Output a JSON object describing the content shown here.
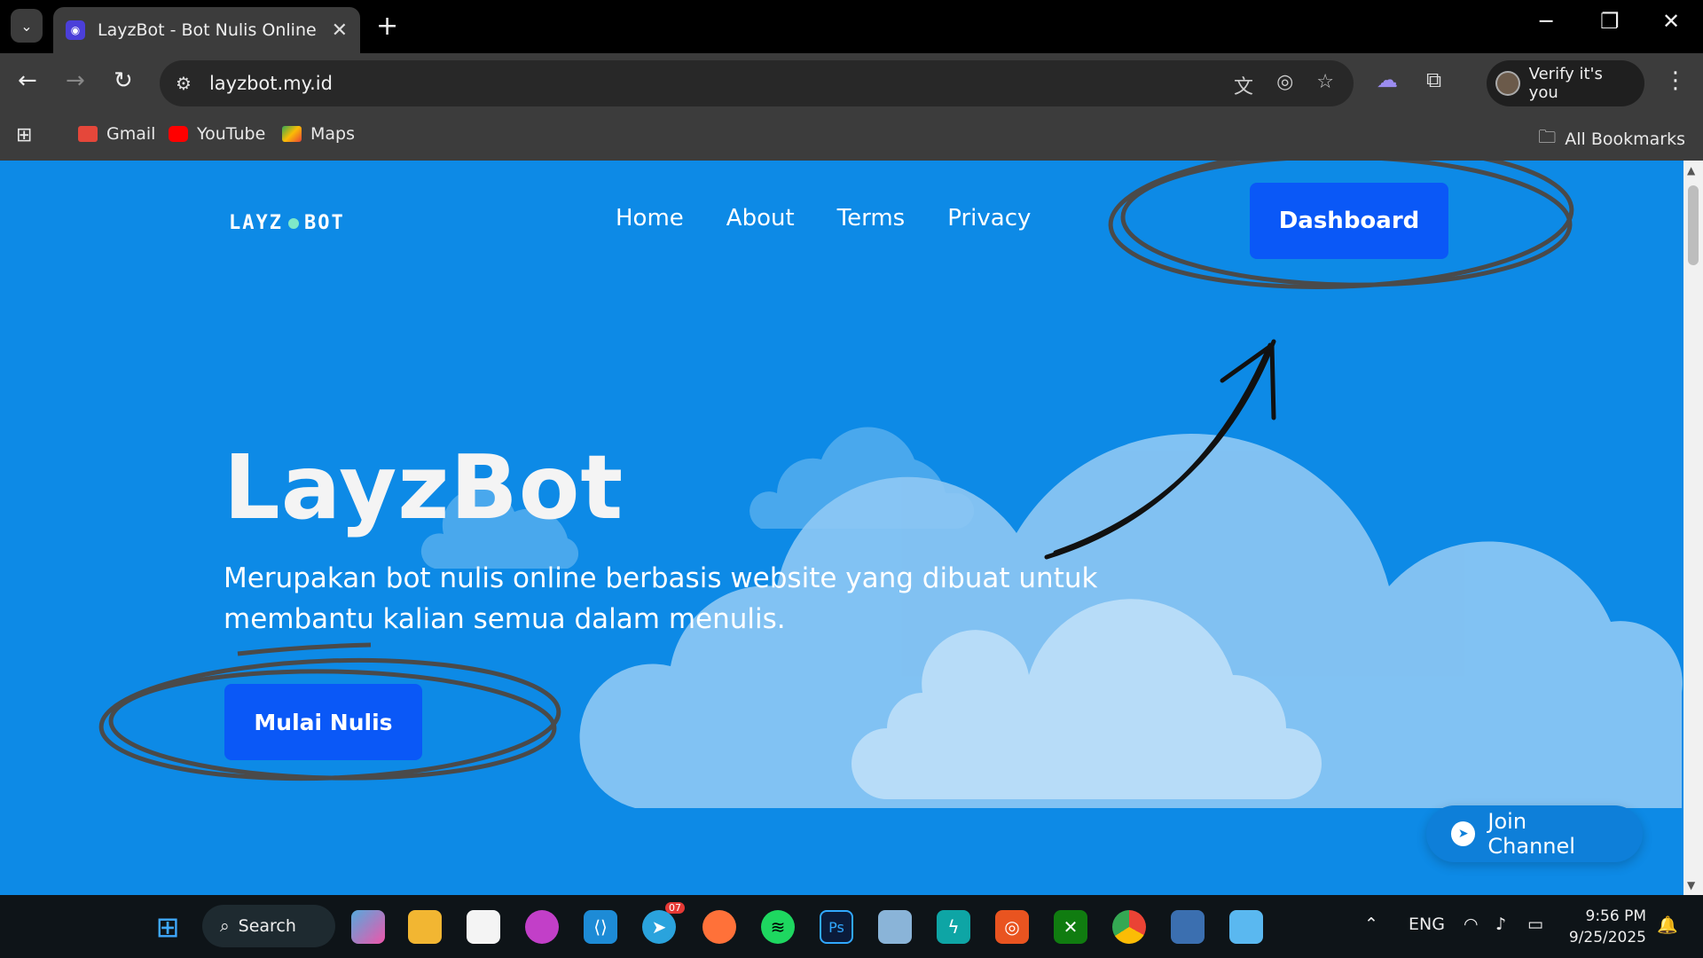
{
  "browser": {
    "tab_title": "LayzBot - Bot Nulis Online",
    "url": "layzbot.my.id",
    "profile_label": "Verify it's you",
    "bookmarks": [
      {
        "label": "Gmail"
      },
      {
        "label": "YouTube"
      },
      {
        "label": "Maps"
      }
    ],
    "all_bookmarks": "All Bookmarks"
  },
  "site": {
    "logo_left": "LAYZ",
    "logo_right": "BOT",
    "nav": [
      "Home",
      "About",
      "Terms",
      "Privacy"
    ],
    "dashboard_label": "Dashboard",
    "hero_title": "LayzBot",
    "hero_subtitle": "Merupakan bot nulis online berbasis website yang dibuat untuk membantu kalian semua dalam menulis.",
    "cta_label": "Mulai Nulis",
    "join_label": "Join Channel"
  },
  "taskbar": {
    "search_label": "Search",
    "lang": "ENG",
    "time": "9:56 PM",
    "date": "9/25/2025",
    "badge": "07"
  },
  "colors": {
    "page_bg": "#0d8ae6",
    "button_bg": "#0a58f7"
  }
}
